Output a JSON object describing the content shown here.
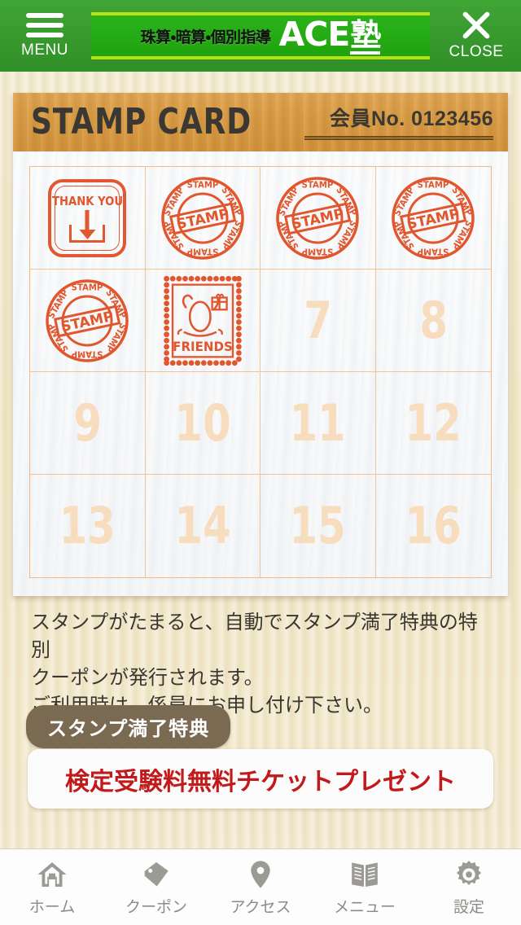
{
  "header": {
    "menu_label": "MENU",
    "menu_icon": "hamburger-icon",
    "close_label": "CLOSE",
    "close_icon": "close-x-icon",
    "logo_sub": "珠算・暗算・個別指導",
    "logo_main_en": "ACE",
    "logo_main_jp": "塾",
    "bg_color": "#37992d",
    "banner_bg": "#25ac14",
    "banner_border": "#b6e413"
  },
  "card": {
    "title": "STAMP CARD",
    "member_label": "会員No. 0123456",
    "header_bg": "#d99c45",
    "grid_border": "#f3c295",
    "stamp_color": "#e04a1e",
    "cells": [
      {
        "index": 1,
        "state": "stamped",
        "stamp_type": "thank-you",
        "label": "THANK YOU"
      },
      {
        "index": 2,
        "state": "stamped",
        "stamp_type": "seal",
        "label": "STAMP"
      },
      {
        "index": 3,
        "state": "stamped",
        "stamp_type": "seal",
        "label": "STAMP"
      },
      {
        "index": 4,
        "state": "stamped",
        "stamp_type": "seal",
        "label": "STAMP"
      },
      {
        "index": 5,
        "state": "stamped",
        "stamp_type": "seal",
        "label": "STAMP"
      },
      {
        "index": 6,
        "state": "stamped",
        "stamp_type": "friends",
        "label": "FRIENDS"
      },
      {
        "index": 7,
        "state": "empty",
        "stamp_type": "none",
        "label": "7"
      },
      {
        "index": 8,
        "state": "empty",
        "stamp_type": "none",
        "label": "8"
      },
      {
        "index": 9,
        "state": "empty",
        "stamp_type": "none",
        "label": "9"
      },
      {
        "index": 10,
        "state": "empty",
        "stamp_type": "none",
        "label": "10"
      },
      {
        "index": 11,
        "state": "empty",
        "stamp_type": "none",
        "label": "11"
      },
      {
        "index": 12,
        "state": "empty",
        "stamp_type": "none",
        "label": "12"
      },
      {
        "index": 13,
        "state": "empty",
        "stamp_type": "none",
        "label": "13"
      },
      {
        "index": 14,
        "state": "empty",
        "stamp_type": "none",
        "label": "14"
      },
      {
        "index": 15,
        "state": "empty",
        "stamp_type": "none",
        "label": "15"
      },
      {
        "index": 16,
        "state": "empty",
        "stamp_type": "none",
        "label": "16"
      }
    ]
  },
  "description": {
    "line1": "スタンプがたまると、自動でスタンプ満了特典の特別",
    "line2": "クーポンが発行されます。",
    "line3": "ご利用時は、係員にお申し付け下さい。"
  },
  "reward": {
    "badge_label": "スタンプ満了特典",
    "badge_color": "#7a6a52",
    "text": "検定受験料無料チケットプレゼント",
    "text_color": "#c2191b"
  },
  "bottom_nav": {
    "items": [
      {
        "label": "ホーム",
        "icon": "home-icon"
      },
      {
        "label": "クーポン",
        "icon": "tag-icon"
      },
      {
        "label": "アクセス",
        "icon": "location-pin-icon"
      },
      {
        "label": "メニュー",
        "icon": "book-icon"
      },
      {
        "label": "設定",
        "icon": "gear-icon"
      }
    ]
  }
}
